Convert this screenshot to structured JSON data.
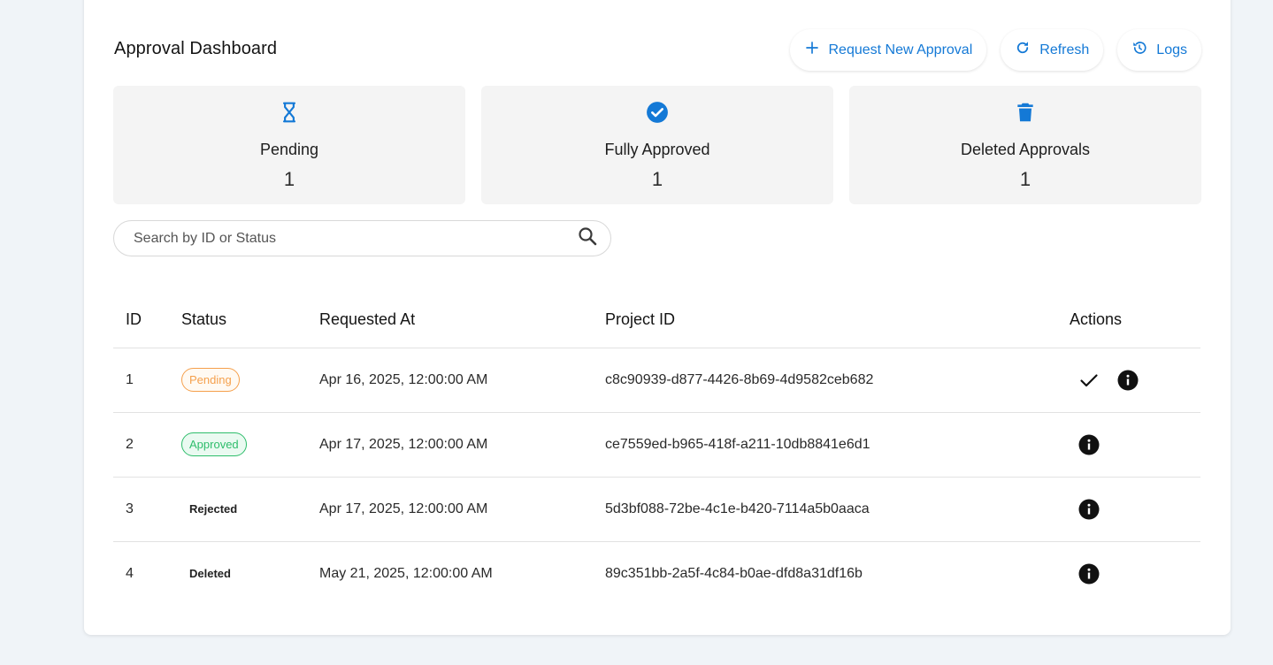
{
  "header": {
    "title": "Approval Dashboard",
    "buttons": {
      "request_new": "Request New Approval",
      "refresh": "Refresh",
      "logs": "Logs"
    }
  },
  "stats": [
    {
      "icon": "hourglass-icon",
      "label": "Pending",
      "value": "1"
    },
    {
      "icon": "check-circle-icon",
      "label": "Fully Approved",
      "value": "1"
    },
    {
      "icon": "trash-icon",
      "label": "Deleted Approvals",
      "value": "1"
    }
  ],
  "search": {
    "placeholder": "Search by ID or Status",
    "value": ""
  },
  "table": {
    "columns": [
      "ID",
      "Status",
      "Requested At",
      "Project ID",
      "Actions"
    ],
    "rows": [
      {
        "id": "1",
        "status": "Pending",
        "requested_at": "Apr 16, 2025, 12:00:00 AM",
        "project_id": "c8c90939-d877-4426-8b69-4d9582ceb682",
        "actions": [
          "approve-check-icon",
          "info-icon"
        ]
      },
      {
        "id": "2",
        "status": "Approved",
        "requested_at": "Apr 17, 2025, 12:00:00 AM",
        "project_id": "ce7559ed-b965-418f-a211-10db8841e6d1",
        "actions": [
          "info-icon"
        ]
      },
      {
        "id": "3",
        "status": "Rejected",
        "requested_at": "Apr 17, 2025, 12:00:00 AM",
        "project_id": "5d3bf088-72be-4c1e-b420-7114a5b0aaca",
        "actions": [
          "info-icon"
        ]
      },
      {
        "id": "4",
        "status": "Deleted",
        "requested_at": "May 21, 2025, 12:00:00 AM",
        "project_id": "89c351bb-2a5f-4c84-b0ae-dfd8a31df16b",
        "actions": [
          "info-icon"
        ]
      }
    ]
  },
  "colors": {
    "accent": "#1479d6",
    "pending": "#f5a04c",
    "approved": "#2ebd6b",
    "background": "#f0f4f8"
  }
}
